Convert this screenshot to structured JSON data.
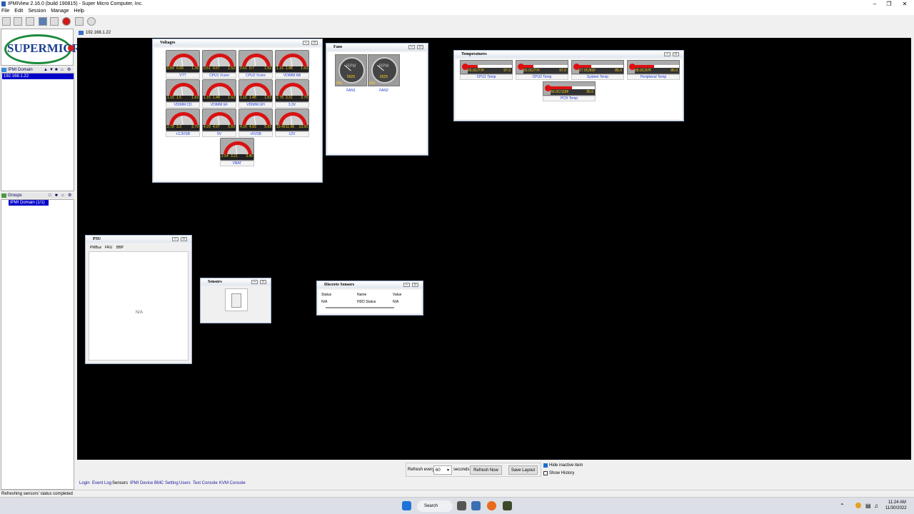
{
  "window": {
    "title": "IPMIView 2.16.0 (build 190815) - Super Micro Computer, Inc."
  },
  "menu": [
    "File",
    "Edit",
    "Session",
    "Manage",
    "Help"
  ],
  "logo_text": "SUPERMICRO",
  "domain_panel": {
    "title": "IPMI Domain",
    "items": [
      "192.168.1.22"
    ]
  },
  "groups_panel": {
    "title": "Groups",
    "items": [
      "IPMI Domain (1/1)"
    ]
  },
  "address": "192.168.1.22",
  "voltages": {
    "title": "Voltages",
    "gauges": [
      {
        "label": "VTT",
        "min": "0.89",
        "cur": "0.99",
        "max": "1.39"
      },
      {
        "label": "CPU1 Vcore",
        "min": "0.51",
        "cur": "0.67",
        "max": "1.52"
      },
      {
        "label": "CPU2 Vcore",
        "min": "0.51",
        "cur": "0.7",
        "max": "1.52"
      },
      {
        "label": "VDIMM AB",
        "min": "1.15",
        "cur": "1.48",
        "max": "1.63"
      },
      {
        "label": "VDIMM CD",
        "min": "1.15",
        "cur": "1.5",
        "max": "1.63"
      },
      {
        "label": "VDIMM EF",
        "min": "1.15",
        "cur": "1.48",
        "max": "1.63"
      },
      {
        "label": "VDIMM GH",
        "min": "1.15",
        "cur": "1.48",
        "max": "1.63"
      },
      {
        "label": "3.3V",
        "min": "2.78",
        "cur": "3.31",
        "max": "3.79"
      },
      {
        "label": "+3.3VSB",
        "min": "2.78",
        "cur": "3.3",
        "max": "3.79"
      },
      {
        "label": "5V",
        "min": "4.29",
        "cur": "4.97",
        "max": "5.69"
      },
      {
        "label": "+5VSB",
        "min": "4.29",
        "cur": "4.93",
        "max": "5.69"
      },
      {
        "label": "12V",
        "min": "10.49",
        "cur": "11.96",
        "max": "13.56"
      },
      {
        "label": "VBAT",
        "min": "2.54",
        "cur": "3.21",
        "max": "3.45"
      }
    ]
  },
  "fans": {
    "title": "Fans",
    "items": [
      {
        "label": "FAN1",
        "unit": "RPM",
        "min": "450",
        "cur": "5925"
      },
      {
        "label": "FAN2",
        "unit": "RPM",
        "min": "450",
        "cur": "6025"
      }
    ]
  },
  "temperatures": {
    "title": "Temperatures",
    "items": [
      {
        "label": "CPU1 Temp",
        "value": "26.0C/77F",
        "max": "97.0",
        "fill": 0.25
      },
      {
        "label": "CPU2 Temp",
        "value": "25.0C/77F",
        "max": "97.0",
        "fill": 0.25
      },
      {
        "label": "System Temp",
        "value": "27.0C/81F",
        "max": "85.0",
        "fill": 0.3
      },
      {
        "label": "Peripheral Temp",
        "value": "39.0C/97F",
        "max": "85.0",
        "fill": 0.45
      },
      {
        "label": "PCH Temp",
        "value": "50.0C/118F",
        "max": "95.0",
        "fill": 0.5
      }
    ]
  },
  "psu": {
    "title": "PSU",
    "tabs": [
      "PMBus",
      "FRU",
      "BBP"
    ],
    "content": "N/A"
  },
  "sensors": {
    "title": "Sensors"
  },
  "discrete": {
    "title": "Discrete Sensors",
    "headers": [
      "Status",
      "Name",
      "Value"
    ],
    "rows": [
      [
        "N/A",
        "HDD Status",
        "N/A"
      ]
    ]
  },
  "bottom": {
    "refresh_label": "Refresh every",
    "refresh_value": "60",
    "seconds_label": "seconds",
    "refresh_now": "Refresh Now",
    "save_layout": "Save Layout",
    "hide_inactive": "Hide inactive item",
    "show_history": "Show History"
  },
  "tabs": [
    "Login",
    "Event Log",
    "Sensors",
    "IPMI Device",
    "BMC Setting",
    "Users",
    "Text Console",
    "KVM Console"
  ],
  "status": "Refreshing sensors' status completed",
  "taskbar": {
    "search": "Search",
    "time": "11:24 AM",
    "date": "11/30/2022"
  }
}
